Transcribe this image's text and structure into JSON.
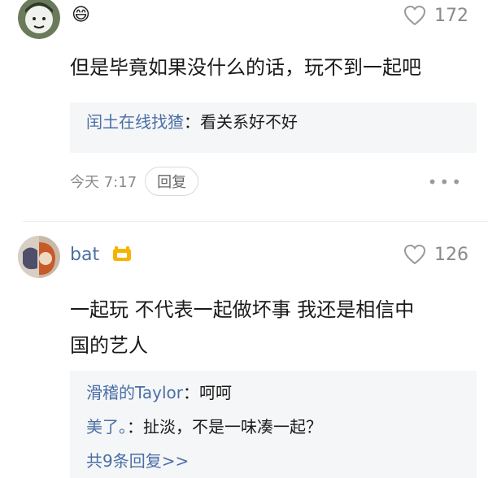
{
  "comments": [
    {
      "user_badge": "😄",
      "like_count": "172",
      "text": "但是毕竟如果没什么的话，玩不到一起吧",
      "replies": [
        {
          "name": "闰土在线找猹",
          "sep": "：",
          "text": "看关系好不好"
        }
      ],
      "time": "今天 7:17",
      "reply_label": "回复",
      "more": "•••"
    },
    {
      "user_name": "bat",
      "like_count": "126",
      "text_line1": "一起玩 不代表一起做坏事 我还是相信中",
      "text_line2": "国的艺人",
      "replies": [
        {
          "name": "滑稽的Taylor",
          "sep": "：",
          "text": "呵呵"
        },
        {
          "name": "美了。",
          "sep": "：",
          "text": "扯淡，不是一味凑一起？"
        }
      ],
      "more_replies": "共9条回复>>"
    }
  ],
  "colors": {
    "link": "#4a6fa5",
    "badge_gold": "#f5b400",
    "meta": "#8a8a8a"
  }
}
